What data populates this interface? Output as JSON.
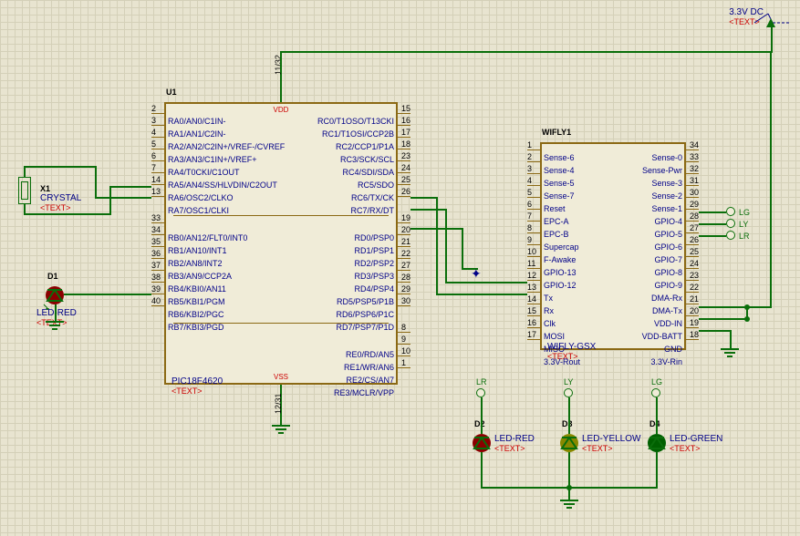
{
  "power": {
    "label": "3.3V DC",
    "text": "<TEXT>"
  },
  "u1": {
    "ref": "U1",
    "part": "PIC18F4620",
    "text": "<TEXT>",
    "vdd": "VDD",
    "vss": "VSS",
    "vdd_pins": "11/32",
    "vss_pins": "12/31",
    "left_pins": [
      {
        "num": "2",
        "name": "RA0/AN0/C1IN-"
      },
      {
        "num": "3",
        "name": "RA1/AN1/C2IN-"
      },
      {
        "num": "4",
        "name": "RA2/AN2/C2IN+/VREF-/CVREF"
      },
      {
        "num": "5",
        "name": "RA3/AN3/C1IN+/VREF+"
      },
      {
        "num": "6",
        "name": "RA4/T0CKI/C1OUT"
      },
      {
        "num": "7",
        "name": "RA5/AN4/SS/HLVDIN/C2OUT"
      },
      {
        "num": "14",
        "name": "RA6/OSC2/CLKO"
      },
      {
        "num": "13",
        "name": "RA7/OSC1/CLKI"
      },
      {
        "num": "33",
        "name": "RB0/AN12/FLT0/INT0"
      },
      {
        "num": "34",
        "name": "RB1/AN10/INT1"
      },
      {
        "num": "35",
        "name": "RB2/AN8/INT2"
      },
      {
        "num": "36",
        "name": "RB3/AN9/CCP2A"
      },
      {
        "num": "37",
        "name": "RB4/KBI0/AN11"
      },
      {
        "num": "38",
        "name": "RB5/KBI1/PGM"
      },
      {
        "num": "39",
        "name": "RB6/KBI2/PGC"
      },
      {
        "num": "40",
        "name": "RB7/KBI3/PGD"
      }
    ],
    "right_pins": [
      {
        "num": "15",
        "name": "RC0/T1OSO/T13CKI"
      },
      {
        "num": "16",
        "name": "RC1/T1OSI/CCP2B"
      },
      {
        "num": "17",
        "name": "RC2/CCP1/P1A"
      },
      {
        "num": "18",
        "name": "RC3/SCK/SCL"
      },
      {
        "num": "23",
        "name": "RC4/SDI/SDA"
      },
      {
        "num": "24",
        "name": "RC5/SDO"
      },
      {
        "num": "25",
        "name": "RC6/TX/CK"
      },
      {
        "num": "26",
        "name": "RC7/RX/DT"
      },
      {
        "num": "19",
        "name": "RD0/PSP0"
      },
      {
        "num": "20",
        "name": "RD1/PSP1"
      },
      {
        "num": "21",
        "name": "RD2/PSP2"
      },
      {
        "num": "22",
        "name": "RD3/PSP3"
      },
      {
        "num": "27",
        "name": "RD4/PSP4"
      },
      {
        "num": "28",
        "name": "RD5/PSP5/P1B"
      },
      {
        "num": "29",
        "name": "RD6/PSP6/P1C"
      },
      {
        "num": "30",
        "name": "RD7/PSP7/P1D"
      },
      {
        "num": "8",
        "name": "RE0/RD/AN5"
      },
      {
        "num": "9",
        "name": "RE1/WR/AN6"
      },
      {
        "num": "10",
        "name": "RE2/CS/AN7"
      },
      {
        "num": "1",
        "name": "RE3/MCLR/VPP"
      }
    ]
  },
  "wifly": {
    "ref": "WIFLY1",
    "part": "WIFLY-GSX",
    "text": "<TEXT>",
    "left_pins": [
      {
        "num": "1",
        "name": "Sense-6"
      },
      {
        "num": "2",
        "name": "Sense-4"
      },
      {
        "num": "3",
        "name": "Sense-5"
      },
      {
        "num": "4",
        "name": "Sense-7"
      },
      {
        "num": "5",
        "name": "Reset"
      },
      {
        "num": "6",
        "name": "EPC-A"
      },
      {
        "num": "7",
        "name": "EPC-B"
      },
      {
        "num": "8",
        "name": "Supercap"
      },
      {
        "num": "9",
        "name": "F-Awake"
      },
      {
        "num": "10",
        "name": "GPIO-13"
      },
      {
        "num": "11",
        "name": "GPIO-12"
      },
      {
        "num": "12",
        "name": "Tx"
      },
      {
        "num": "13",
        "name": "Rx"
      },
      {
        "num": "14",
        "name": "Clk"
      },
      {
        "num": "15",
        "name": "MOSI"
      },
      {
        "num": "16",
        "name": "MISO"
      },
      {
        "num": "17",
        "name": "3.3V-Rout"
      }
    ],
    "right_pins": [
      {
        "num": "34",
        "name": "Sense-0"
      },
      {
        "num": "33",
        "name": "Sense-Pwr"
      },
      {
        "num": "32",
        "name": "Sense-3"
      },
      {
        "num": "31",
        "name": "Sense-2"
      },
      {
        "num": "30",
        "name": "Sense-1"
      },
      {
        "num": "29",
        "name": "GPIO-4"
      },
      {
        "num": "28",
        "name": "GPIO-5"
      },
      {
        "num": "27",
        "name": "GPIO-6"
      },
      {
        "num": "26",
        "name": "GPIO-7"
      },
      {
        "num": "25",
        "name": "GPIO-8"
      },
      {
        "num": "24",
        "name": "GPIO-9"
      },
      {
        "num": "23",
        "name": "DMA-Rx"
      },
      {
        "num": "22",
        "name": "DMA-Tx"
      },
      {
        "num": "21",
        "name": "VDD-IN"
      },
      {
        "num": "20",
        "name": "VDD-BATT"
      },
      {
        "num": "19",
        "name": "GND"
      },
      {
        "num": "18",
        "name": "3.3V-Rin"
      }
    ]
  },
  "x1": {
    "ref": "X1",
    "part": "CRYSTAL",
    "text": "<TEXT>"
  },
  "d1": {
    "ref": "D1",
    "part": "LED-RED",
    "text": "<TEXT>"
  },
  "d2": {
    "ref": "D2",
    "part": "LED-RED",
    "text": "<TEXT>"
  },
  "d3": {
    "ref": "D3",
    "part": "LED-YELLOW",
    "text": "<TEXT>"
  },
  "d4": {
    "ref": "D4",
    "part": "LED-GREEN",
    "text": "<TEXT>"
  },
  "terminals": {
    "lg": "LG",
    "ly": "LY",
    "lr": "LR"
  }
}
